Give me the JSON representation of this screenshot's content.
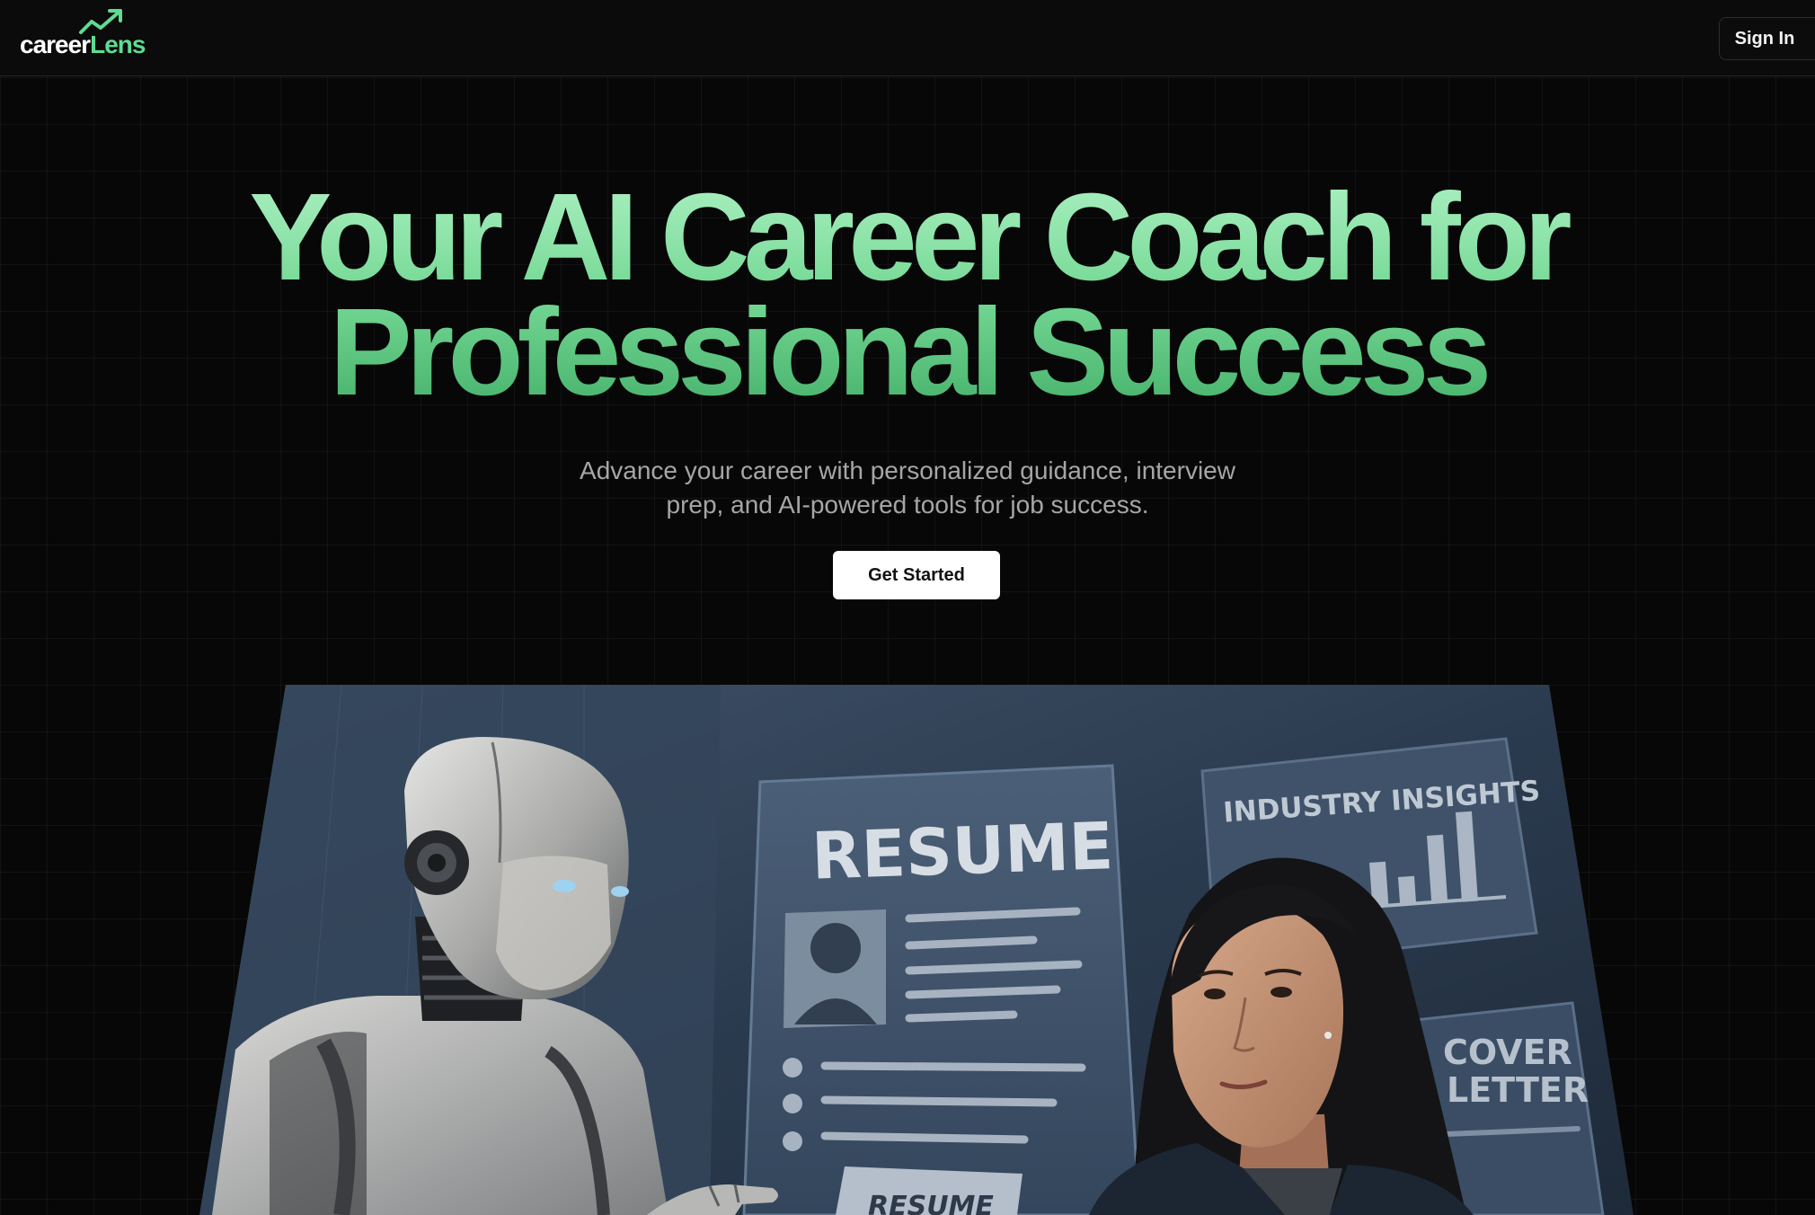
{
  "header": {
    "logo": {
      "text_part1": "career",
      "text_part2": "Lens",
      "icon": "trend-up-icon",
      "accent_color": "#5fdc91"
    },
    "signin_label": "Sign In"
  },
  "hero": {
    "title": "Your AI Career Coach for Professional Success",
    "subtitle": "Advance your career with personalized guidance, interview prep, and AI-powered tools for job success.",
    "cta_label": "Get Started"
  },
  "hero_image": {
    "resume_label": "RESUME",
    "insights_label": "INDUSTRY INSIGHTS",
    "cover_letter_label_line1": "COVER",
    "cover_letter_label_line2": "LETTER",
    "small_card_label": "RESUME"
  }
}
